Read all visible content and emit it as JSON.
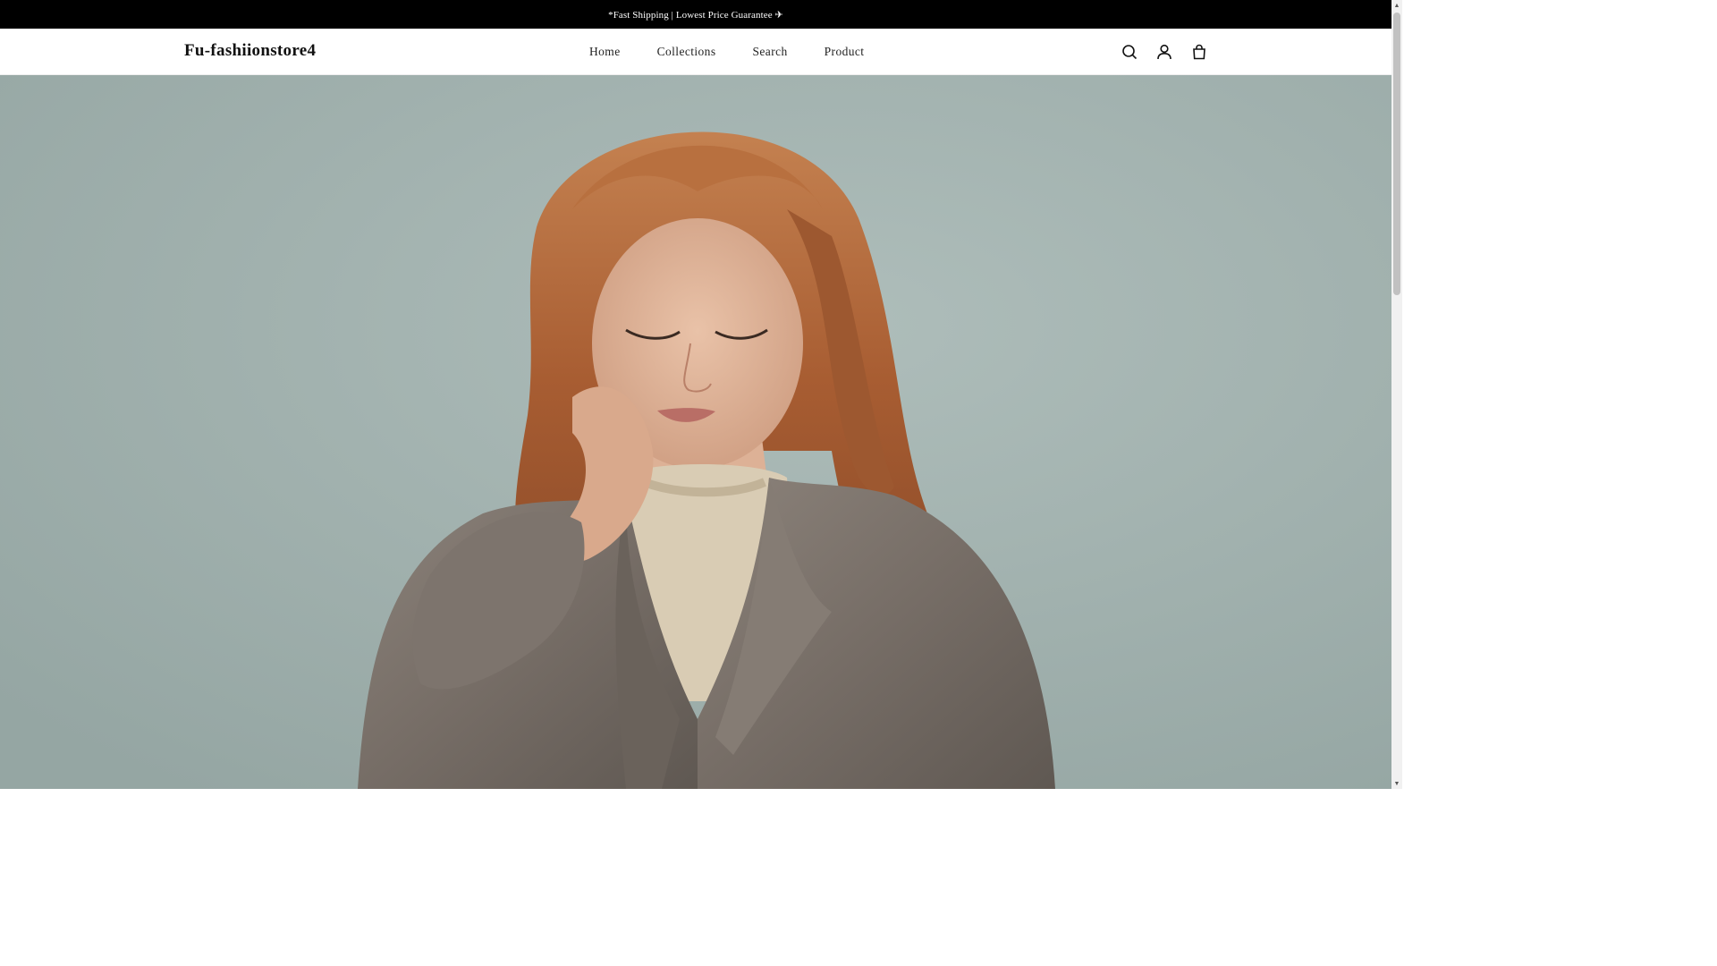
{
  "announcement": {
    "text": "*Fast Shipping | Lowest Price Guarantee ✈"
  },
  "header": {
    "logo": "Fu-fashiionstore4",
    "nav": [
      {
        "label": "Home"
      },
      {
        "label": "Collections"
      },
      {
        "label": "Search"
      },
      {
        "label": "Product"
      }
    ],
    "icons": [
      "search-icon",
      "account-icon",
      "cart-icon"
    ]
  },
  "hero": {
    "image": "woman-in-grey-wool-coat",
    "background_color": "#a3b2b0",
    "coat_color": "#7d736b",
    "hair_color": "#b0673a"
  }
}
